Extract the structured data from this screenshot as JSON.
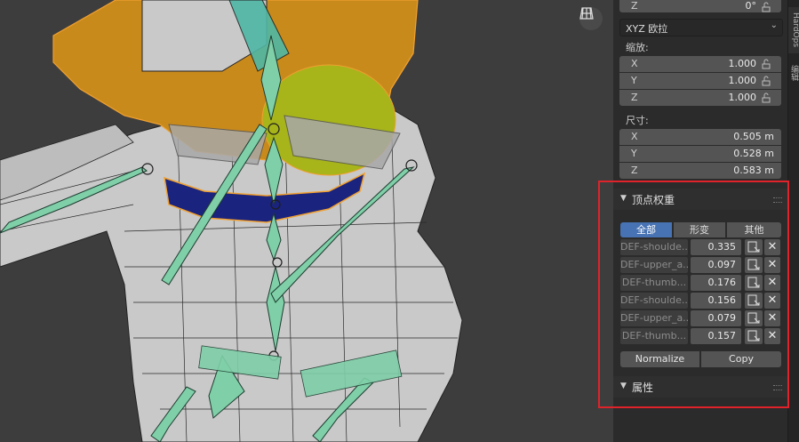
{
  "transform": {
    "rotation_z": {
      "axis": "Z",
      "value": "0°"
    },
    "rotation_mode": "XYZ 欧拉",
    "scale_label": "缩放:",
    "scale": [
      {
        "axis": "X",
        "value": "1.000"
      },
      {
        "axis": "Y",
        "value": "1.000"
      },
      {
        "axis": "Z",
        "value": "1.000"
      }
    ],
    "dimensions_label": "尺寸:",
    "dimensions": [
      {
        "axis": "X",
        "value": "0.505 m"
      },
      {
        "axis": "Y",
        "value": "0.528 m"
      },
      {
        "axis": "Z",
        "value": "0.583 m"
      }
    ]
  },
  "vertex_weights": {
    "title": "顶点权重",
    "filters": [
      "全部",
      "形变",
      "其他"
    ],
    "active_filter": "全部",
    "groups": [
      {
        "name": "DEF-shoulde...",
        "weight": "0.335"
      },
      {
        "name": "DEF-upper_a...",
        "weight": "0.097"
      },
      {
        "name": "DEF-thumb...",
        "weight": "0.176"
      },
      {
        "name": "DEF-shoulde...",
        "weight": "0.156"
      },
      {
        "name": "DEF-upper_a...",
        "weight": "0.079"
      },
      {
        "name": "DEF-thumb...",
        "weight": "0.157"
      }
    ],
    "normalize_label": "Normalize",
    "copy_label": "Copy"
  },
  "properties_panel": {
    "title": "属性"
  },
  "side_tabs": [
    "HardOps",
    "编辑"
  ],
  "colors": {
    "highlight": "#e0222a",
    "active_blue": "#4772b3",
    "bone": "#7fcfa8",
    "selected_edge": "#f0a030"
  }
}
